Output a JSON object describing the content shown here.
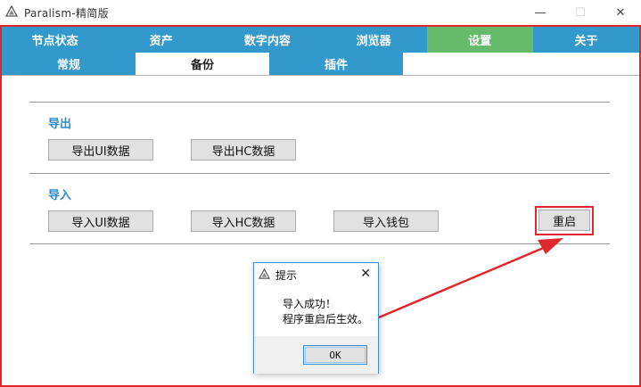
{
  "window": {
    "title": "Paralism-精简版",
    "minimize_glyph": "—",
    "maximize_glyph": "☐",
    "close_glyph": "✕"
  },
  "main_tabs": [
    {
      "label": "节点状态",
      "active": false
    },
    {
      "label": "资产",
      "active": false
    },
    {
      "label": "数字内容",
      "active": false
    },
    {
      "label": "浏览器",
      "active": false
    },
    {
      "label": "设置",
      "active": true
    },
    {
      "label": "关于",
      "active": false
    }
  ],
  "sub_tabs": [
    {
      "label": "常规",
      "active": false
    },
    {
      "label": "备份",
      "active": true
    },
    {
      "label": "插件",
      "active": false
    }
  ],
  "backup": {
    "export_label": "导出",
    "export_ui_button": "导出UI数据",
    "export_hc_button": "导出HC数据",
    "import_label": "导入",
    "import_ui_button": "导入UI数据",
    "import_hc_button": "导入HC数据",
    "import_wallet_button": "导入钱包",
    "restart_button": "重启"
  },
  "dialog": {
    "title": "提示",
    "close_glyph": "✕",
    "message_line1": "导入成功！",
    "message_line2": "程序重启后生效。",
    "ok_button": "OK"
  },
  "colors": {
    "tab_blue": "#3399cc",
    "tab_active_green": "#66bb6a",
    "section_label_blue": "#2a8bc9",
    "annotation_red": "#e0272c"
  },
  "icons": {
    "app_icon": "triangle-logo-icon",
    "dialog_icon": "triangle-logo-icon",
    "annotation": "red-arrow-icon"
  }
}
